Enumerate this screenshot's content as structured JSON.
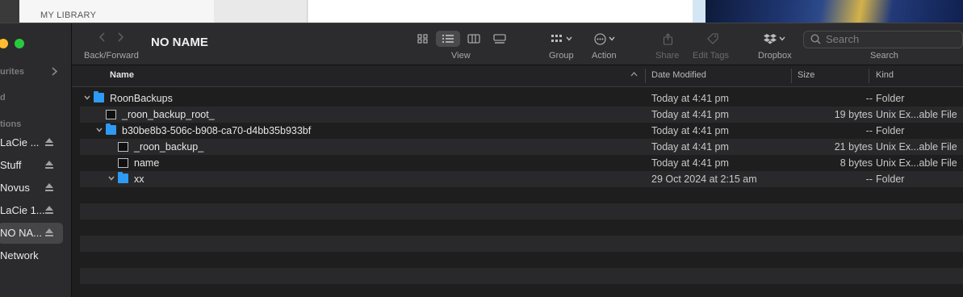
{
  "background": {
    "library_label": "MY LIBRARY"
  },
  "sidebar": {
    "sections": [
      {
        "label": "urites",
        "name": "favourites"
      },
      {
        "label": "d",
        "name": "cloud"
      },
      {
        "label": "tions",
        "name": "locations"
      }
    ],
    "items": [
      {
        "label": "LaCie ...",
        "eject": true
      },
      {
        "label": "Stuff",
        "eject": true
      },
      {
        "label": "Novus",
        "eject": true
      },
      {
        "label": "LaCie 1...",
        "eject": true
      },
      {
        "label": "NO NA...",
        "eject": true,
        "selected": true
      },
      {
        "label": "Network",
        "eject": false
      }
    ]
  },
  "toolbar": {
    "back_forward_label": "Back/Forward",
    "window_title": "NO NAME",
    "view_label": "View",
    "group_label": "Group",
    "action_label": "Action",
    "share_label": "Share",
    "edit_tags_label": "Edit Tags",
    "dropbox_label": "Dropbox",
    "search_label": "Search",
    "search_placeholder": "Search"
  },
  "columns": {
    "name": "Name",
    "date_modified": "Date Modified",
    "size": "Size",
    "kind": "Kind"
  },
  "rows": [
    {
      "indent": 0,
      "type": "folder",
      "expanded": true,
      "name": "RoonBackups",
      "date": "Today at 4:41 pm",
      "size": "--",
      "kind": "Folder"
    },
    {
      "indent": 1,
      "type": "file",
      "name": "_roon_backup_root_",
      "date": "Today at 4:41 pm",
      "size": "19 bytes",
      "kind": "Unix Ex...able File"
    },
    {
      "indent": 1,
      "type": "folder",
      "expanded": true,
      "name": "b30be8b3-506c-b908-ca70-d4bb35b933bf",
      "date": "Today at 4:41 pm",
      "size": "--",
      "kind": "Folder"
    },
    {
      "indent": 2,
      "type": "file",
      "name": "_roon_backup_",
      "date": "Today at 4:41 pm",
      "size": "21 bytes",
      "kind": "Unix Ex...able File"
    },
    {
      "indent": 2,
      "type": "file",
      "name": "name",
      "date": "Today at 4:41 pm",
      "size": "8 bytes",
      "kind": "Unix Ex...able File"
    },
    {
      "indent": 2,
      "type": "folder",
      "expanded": true,
      "name": "xx",
      "date": "29 Oct 2024 at 2:15 am",
      "size": "--",
      "kind": "Folder"
    }
  ],
  "colors": {
    "accent_folder": "#2f9af3",
    "window_bg": "#1e1e1e",
    "sidebar_bg": "#2b2a2c",
    "traffic_yellow": "#febc2e",
    "traffic_green": "#28c840"
  }
}
